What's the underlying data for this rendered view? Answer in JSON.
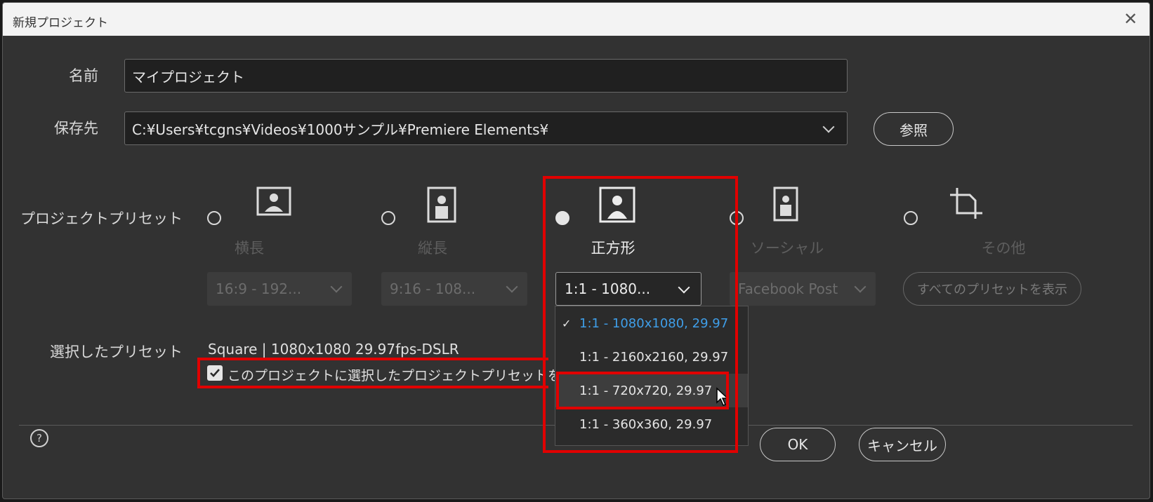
{
  "window": {
    "title": "新規プロジェクト",
    "close_glyph": "✕"
  },
  "name_field": {
    "label": "名前",
    "value": "マイプロジェクト"
  },
  "location_field": {
    "label": "保存先",
    "value": "C:¥Users¥tcgns¥Videos¥1000サンプル¥Premiere Elements¥",
    "browse_label": "参照"
  },
  "preset_section": {
    "label": "プロジェクトプリセット",
    "presets": [
      {
        "label": "横長",
        "icon": "landscape-photo-icon",
        "select_value": "16:9 - 192...",
        "checked": false
      },
      {
        "label": "縦長",
        "icon": "portrait-photo-icon",
        "select_value": "9:16 - 108...",
        "checked": false
      },
      {
        "label": "正方形",
        "icon": "square-photo-icon",
        "select_value": "1:1 - 1080...",
        "checked": true
      },
      {
        "label": "ソーシャル",
        "icon": "social-portrait-icon",
        "select_value": "Facebook Post",
        "checked": false
      },
      {
        "label": "その他",
        "icon": "crop-icon",
        "select_value": "すべてのプリセットを表示",
        "checked": false
      }
    ]
  },
  "dropdown": {
    "items": [
      {
        "label": "1:1 - 1080x1080, 29.97",
        "selected": true
      },
      {
        "label": "1:1 - 2160x2160, 29.97",
        "selected": false
      },
      {
        "label": "1:1 - 720x720, 29.97",
        "selected": false,
        "hover": true
      },
      {
        "label": "1:1 - 360x360, 29.97",
        "selected": false
      }
    ],
    "check_glyph": "✓"
  },
  "selected_preset": {
    "label": "選択したプリセット",
    "value": "Square | 1080x1080 29.97fps-DSLR",
    "checkbox_label": "このプロジェクトに選択したプロジェクトプリセットを適",
    "checkbox_checked": true
  },
  "footer": {
    "help_glyph": "?",
    "ok_label": "OK",
    "cancel_label": "キャンセル"
  },
  "colors": {
    "accent": "#3f9ee8",
    "highlight": "#e10000",
    "background": "#323232"
  }
}
